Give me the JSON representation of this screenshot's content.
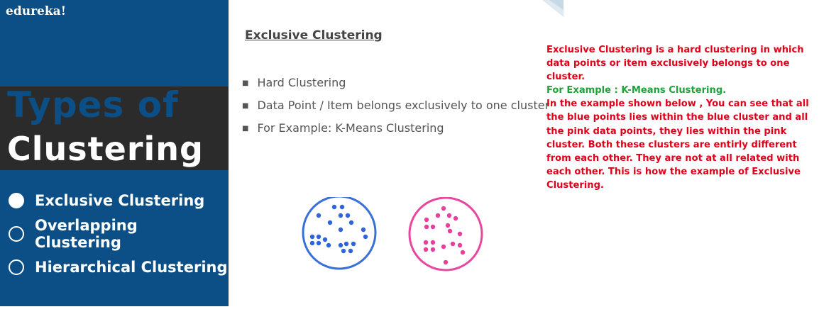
{
  "brand": "edureka!",
  "title": {
    "line1": "Types of",
    "line2": "Clustering"
  },
  "menu": {
    "items": [
      {
        "label": "Exclusive Clustering",
        "selected": true
      },
      {
        "label": "Overlapping Clustering",
        "selected": false
      },
      {
        "label": "Hierarchical Clustering",
        "selected": false
      }
    ]
  },
  "slide": {
    "heading": "Exclusive Clustering",
    "bullets": [
      "Hard Clustering",
      "Data Point / Item belongs exclusively to one cluster",
      "For Example: K-Means Clustering"
    ]
  },
  "explanation": {
    "intro": "Exclusive Clustering is a hard clustering in which data points or item exclusively belongs to one cluster.",
    "example": "For Example : K-Means Clustering.",
    "body": "In the example shown below , You can see that all the blue points lies within the blue cluster and all the pink data points, they lies within the pink cluster. Both these clusters are entirly different from each other. They are not at all related with each other. This is how the example of Exclusive Clustering."
  },
  "colors": {
    "panel": "#0b4f86",
    "band": "#2b2b2b",
    "blue_cluster": "#2f6fe0",
    "pink_cluster": "#ea3f9b",
    "explain_text": "#e0001a",
    "example_text": "#1fa33a"
  }
}
